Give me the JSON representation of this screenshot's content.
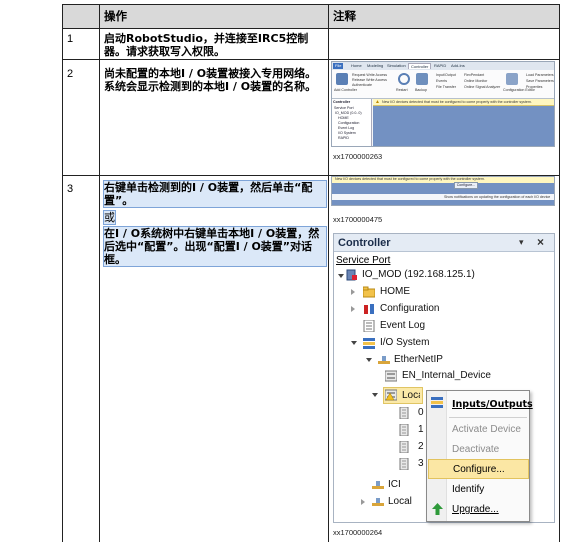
{
  "table": {
    "header": {
      "col_step": "",
      "col_action": "操作",
      "col_note": "注释"
    },
    "rows": [
      {
        "num": "1",
        "action": "启动RobotStudio，并连接至IRC5控制器。请求获取写入权限。",
        "note_caption": ""
      },
      {
        "num": "2",
        "action": "尚未配置的本地I / O装置被接入专用网络。系统会显示检测到的本地I / O装置的名称。",
        "note_caption": "xx1700000263"
      },
      {
        "num": "3",
        "action_a": "右键单击检测到的I / O装置，然后单击“配置”。",
        "action_or": "或",
        "action_b": "在I / O系统树中右键单击本地I / O装置，然后选中“配置”。出现“配置I / O装置”对话框。",
        "note_caption_1": "xx1700000475",
        "note_caption_2": "xx1700000264"
      }
    ]
  },
  "shot1": {
    "tabs": [
      "File",
      "Home",
      "Modeling",
      "Simulation",
      "Controller",
      "RAPID",
      "Add-Ins"
    ],
    "active_tab": "Controller",
    "ribbon_labels": [
      "Add Controller",
      "Request Write Access",
      "Release Write Access",
      "Authenticate",
      "Restart",
      "Backup",
      "Input/Output",
      "Events",
      "File Transfer",
      "FlexPendant",
      "Online Monitor",
      "Online Signal Analyzer",
      "Configuration Editor",
      "Load Parameters",
      "Save Parameters",
      "Properties"
    ],
    "tree_items": [
      "Controller",
      "Service Port",
      "IO_MOD (0.0..0)",
      "HOME",
      "Configuration",
      "Event Log",
      "I/O System",
      "RAPID"
    ],
    "warning": "New I/O devices detected that must be configured to come properly with the controller system."
  },
  "shot2": {
    "banner": "New I/O devices detected that must be configured to come properly with the controller system.",
    "button": "Configure...",
    "status": "Show notifications on updating the configuration of each I/O device"
  },
  "controller": {
    "title": "Controller",
    "pin": "▾",
    "close": "×",
    "service_port": "Service Port",
    "tree": {
      "io_mod": "IO_MOD (192.168.125.1)",
      "home": "HOME",
      "configuration": "Configuration",
      "event_log": "Event Log",
      "io_system": "I/O System",
      "ethernetip": "EtherNetIP",
      "en_internal": "EN_Internal_Device",
      "local_io": "Local_IO",
      "sub0": "0",
      "sub1": "1",
      "sub2": "2",
      "sub3": "3",
      "ici": "ICI",
      "local": "Local"
    },
    "menu": {
      "inputs_outputs": "Inputs/Outputs",
      "activate": "Activate Device",
      "deactivate": "Deactivate Device",
      "configure": "Configure...",
      "identify": "Identify",
      "upgrade": "Upgrade..."
    }
  },
  "colors": {
    "header_bg": "#d9d9d9",
    "highlight": "#dbe8f8",
    "menu_hover": "#fbe7a4",
    "pane_blue": "#7391c2"
  }
}
